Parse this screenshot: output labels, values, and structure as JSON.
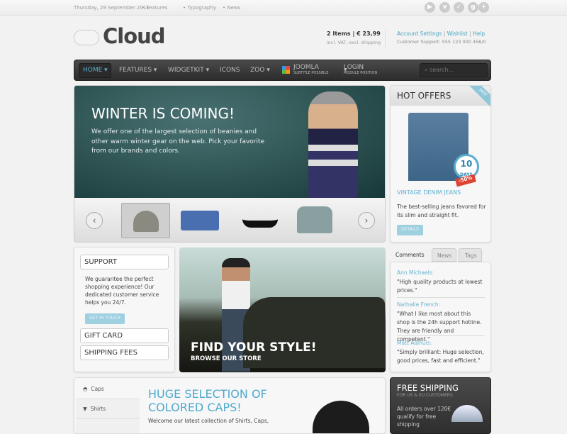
{
  "topbar": {
    "date": "Thursday, 29 September 2011",
    "links": [
      "• Features",
      "• Typography",
      "• News"
    ],
    "social_icons": [
      "play-icon",
      "vimeo-icon",
      "check-icon",
      "google-icon",
      "plus-icon"
    ]
  },
  "header": {
    "logo": "Cloud",
    "cart": "2 Items | € 23,99",
    "cart_note": "incl. VAT, excl. shipping",
    "account": "Account Settings",
    "wishlist": "Wishlist",
    "help": "Help",
    "sep": "|",
    "support": "Customer Support: 555 123 000 456/0"
  },
  "nav": {
    "items": [
      "HOME",
      "FEATURES",
      "WIDGETKIT",
      "ICONS",
      "ZOO",
      "JOOMLA",
      "LOGIN"
    ],
    "joomla_sub": "SUBTITLE POSSIBLE",
    "login_sub": "MODULE POSITION",
    "search_placeholder": "search..."
  },
  "hero": {
    "title": "WINTER IS COMING!",
    "text": "We offer one of the largest selection of beanies and other warm winter gear on the web. Pick your favorite from our brands and colors."
  },
  "hot": {
    "title": "HOT OFFERS",
    "badge": "HOT",
    "days": "10",
    "days_label": "DAYS",
    "discount": "-50%",
    "product": "VINTAGE DENIM JEANS",
    "desc": "The best-selling jeans favored for its slim and straight fit.",
    "button": "DETAILS"
  },
  "support": {
    "title": "SUPPORT",
    "text": "We guarantee the perfect shopping experience! Our dedicated customer service helps you 24/7.",
    "button": "GET IN TOUCH",
    "gift": "GIFT CARD",
    "shipping": "SHIPPING FEES"
  },
  "promo": {
    "title": "FIND YOUR STYLE!",
    "sub": "BROWSE OUR STORE"
  },
  "tabs": {
    "items": [
      "Comments",
      "News",
      "Tags"
    ],
    "comments": [
      {
        "name": "Ann Michaels:",
        "text": "\"High quality products at lowest prices.\""
      },
      {
        "name": "Nathalie French:",
        "text": "\"What I like most about this shop is the 24h support hotline. They are friendly and competent.\""
      },
      {
        "name": "Matt Aalhuis:",
        "text": "\"Simply brilliant: Huge selection, good prices, fast and efficient.\""
      }
    ]
  },
  "caps": {
    "side": [
      "Caps",
      "Shirts"
    ],
    "title": "HUGE SELECTION OF COLORED CAPS!",
    "text": "Welcome our latest collection of Shirts, Caps,"
  },
  "freeship": {
    "title": "FREE SHIPPING",
    "sub": "FOR US & EU CUSTOMERS",
    "text": "All orders over 120€ qualify for free shipping"
  }
}
